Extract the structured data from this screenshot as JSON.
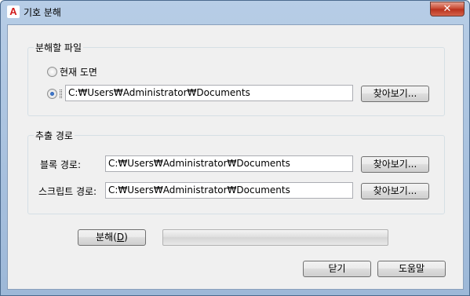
{
  "window": {
    "title": "기호 분해",
    "app_icon_glyph": "A",
    "close_glyph": "✕"
  },
  "split_file": {
    "group_label": "분해할 파일",
    "current_drawing_label": "현재 도면",
    "path_value": "C:₩Users₩Administrator₩Documents",
    "browse_label": "찾아보기...",
    "selected_option": "file_path"
  },
  "extract_path": {
    "group_label": "추출 경로",
    "block_path_label": "블록 경로:",
    "block_path_value": "C:₩Users₩Administrator₩Documents",
    "block_browse_label": "찾아보기...",
    "script_path_label": "스크립트 경로:",
    "script_path_value": "C:₩Users₩Administrator₩Documents",
    "script_browse_label": "찾아보기..."
  },
  "actions": {
    "explode_label": "분해(",
    "explode_mnemonic": "D",
    "explode_label_end": ")",
    "progress_fraction": 0,
    "close_label": "닫기",
    "help_label": "도움말"
  },
  "colors": {
    "titlebar": "#b7cde6",
    "close_button": "#c7432b",
    "dialog_background": "#f0f0f0"
  }
}
